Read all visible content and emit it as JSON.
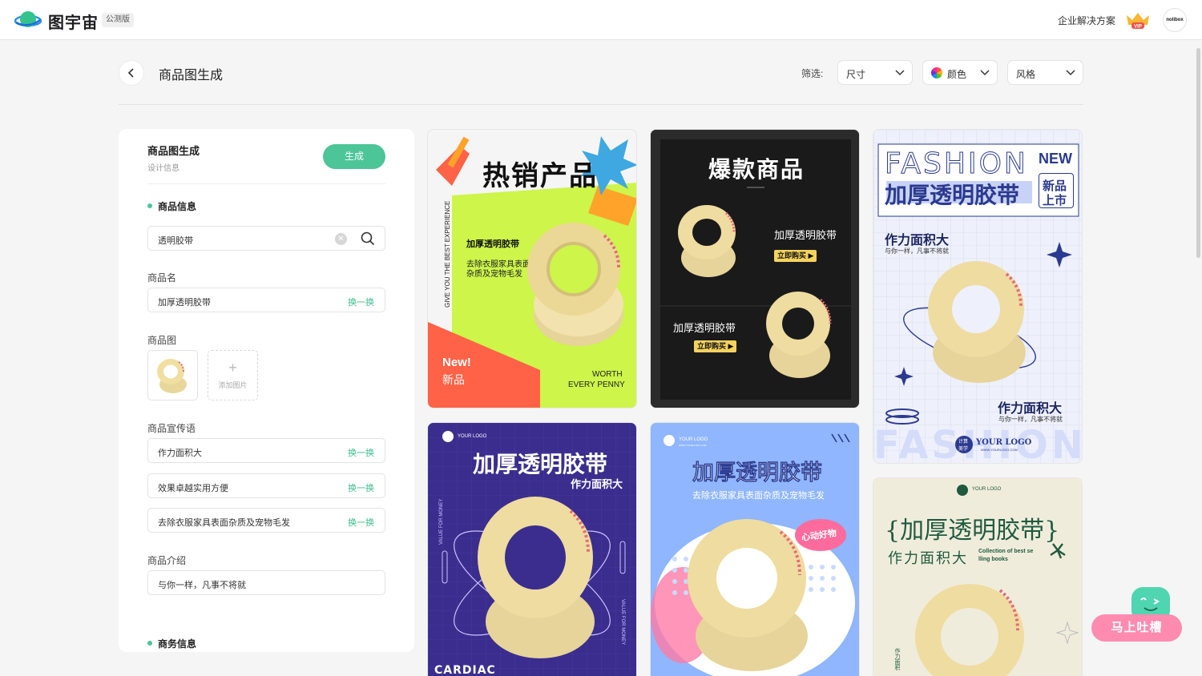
{
  "header": {
    "logo_text": "图宇宙",
    "beta_badge": "公测版",
    "enterprise_link": "企业解决方案",
    "vip_label": "VIP",
    "avatar_text": "nolibox"
  },
  "page": {
    "title": "商品图生成",
    "filter_label": "筛选:",
    "filters": [
      "尺寸",
      "颜色",
      "风格"
    ]
  },
  "panel": {
    "title": "商品图生成",
    "subtitle": "设计信息",
    "generate_label": "生成",
    "product_info_title": "商品信息",
    "search_value": "透明胶带",
    "name_label": "商品名",
    "name_value": "加厚透明胶带",
    "swap_label": "换一换",
    "image_label": "商品图",
    "add_image_label": "添加图片",
    "slogan_label": "商品宣传语",
    "slogans": [
      "作力面积大",
      "效果卓越实用方便",
      "去除衣服家具表面杂质及宠物毛发"
    ],
    "intro_label": "商品介绍",
    "intro_value": "与你一样，凡事不将就",
    "business_info_title": "商务信息"
  },
  "cards": {
    "c1": {
      "title": "热销产品",
      "name": "加厚透明胶带",
      "desc1": "去除衣服家具表面",
      "desc2": "杂质及宠物毛发",
      "side": "GIVE YOU THE BEST EXPERIENCE",
      "new_en": "New!",
      "new_cn": "新品",
      "worth1": "WORTH",
      "worth2": "EVERY PENNY"
    },
    "c2": {
      "title": "爆款商品",
      "name1": "加厚透明胶带",
      "buy1": "立即购买 ▶",
      "name2": "加厚透明胶带",
      "buy2": "立即购买 ▶"
    },
    "c3": {
      "fashion": "FASHION",
      "new_en": "NEW",
      "title": "加厚透明胶带",
      "badge1": "新品",
      "badge2": "上市",
      "sub1": "作力面积大",
      "tag1": "与你一样，凡事不将就",
      "sub2": "作力面积大",
      "tag2": "与你一样，凡事不将就",
      "logo_cn1": "计算",
      "logo_cn2": "美学",
      "logo": "YOUR LOGO",
      "logo_url": "WWW.YOURLOGO.COM",
      "fashion_bottom": "FASHION"
    },
    "c4": {
      "logo": "YOUR LOGO",
      "title": "加厚透明胶带",
      "sub": "作力面积大",
      "side_left": "VALUE FOR MONEY",
      "side_right": "VALUE FOR MONEY",
      "bottom": "CARDIAC"
    },
    "c5": {
      "logo": "YOUR LOGO",
      "logo_url": "WWW.YOURLOGO.COM",
      "title": "加厚透明胶带",
      "sub": "去除衣服家具表面杂质及宠物毛发",
      "badge": "心动好物"
    },
    "c6": {
      "logo": "YOUR LOGO",
      "title": "{加厚透明胶带}",
      "sub": "作力面积大",
      "collection1": "Collection of best se",
      "collection2": "lling books",
      "side": "作力面积"
    }
  },
  "feedback": {
    "label": "马上吐槽"
  },
  "colors": {
    "accent": "#4cc598",
    "feedback": "#ff8bb0"
  }
}
